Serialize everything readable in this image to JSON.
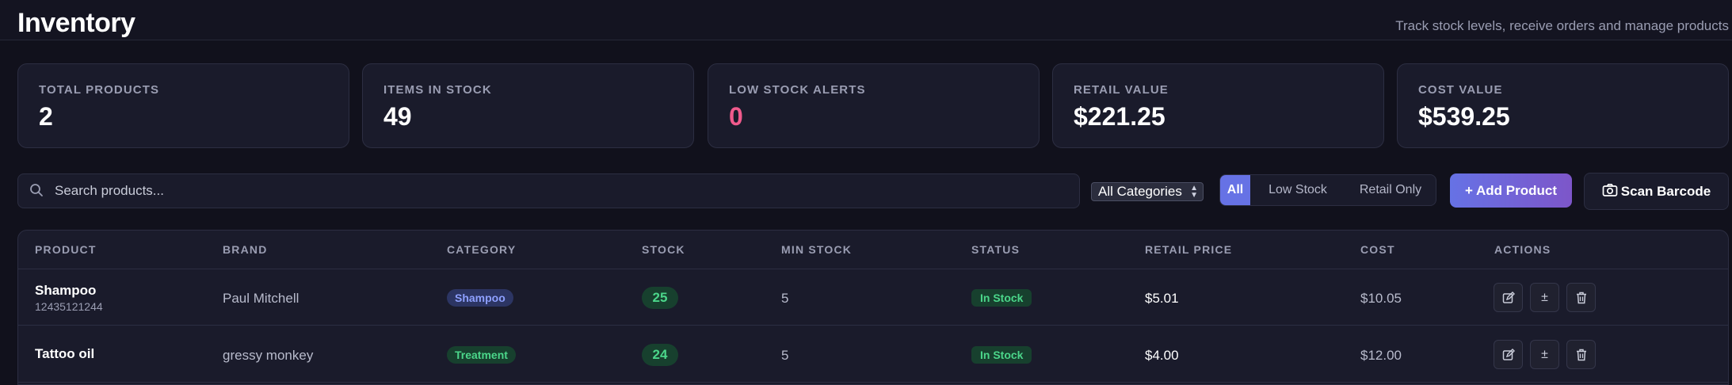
{
  "header": {
    "title": "Inventory",
    "subtitle": "Track stock levels, receive orders and manage products"
  },
  "stats": [
    {
      "label": "TOTAL PRODUCTS",
      "value": "2"
    },
    {
      "label": "ITEMS IN STOCK",
      "value": "49"
    },
    {
      "label": "LOW STOCK ALERTS",
      "value": "0"
    },
    {
      "label": "RETAIL VALUE",
      "value": "$221.25"
    },
    {
      "label": "COST VALUE",
      "value": "$539.25"
    }
  ],
  "toolbar": {
    "search_placeholder": "Search products...",
    "category_selected": "All Categories",
    "filters": [
      "All",
      "Low Stock",
      "Retail Only"
    ],
    "active_filter": "All",
    "add_label": "+ Add Product",
    "scan_label": "Scan Barcode"
  },
  "table": {
    "columns": [
      "PRODUCT",
      "BRAND",
      "CATEGORY",
      "STOCK",
      "MIN STOCK",
      "STATUS",
      "RETAIL PRICE",
      "COST",
      "ACTIONS"
    ],
    "rows": [
      {
        "name": "Shampoo",
        "sku": "12435121244",
        "brand": "Paul Mitchell",
        "category": "Shampoo",
        "stock": "25",
        "min_stock": "5",
        "status": "In Stock",
        "retail_price": "$5.01",
        "cost": "$10.05"
      },
      {
        "name": "Tattoo oil",
        "sku": "",
        "brand": "gressy monkey",
        "category": "Treatment",
        "stock": "24",
        "min_stock": "5",
        "status": "In Stock",
        "retail_price": "$4.00",
        "cost": "$12.00"
      }
    ],
    "action_icons": [
      "edit-icon",
      "adjust-stock-icon",
      "delete-icon"
    ],
    "adjust_symbol": "±"
  },
  "colors": {
    "accent": "#6672e5",
    "alert": "#f05a8c",
    "in_stock": "#4bd68a"
  }
}
